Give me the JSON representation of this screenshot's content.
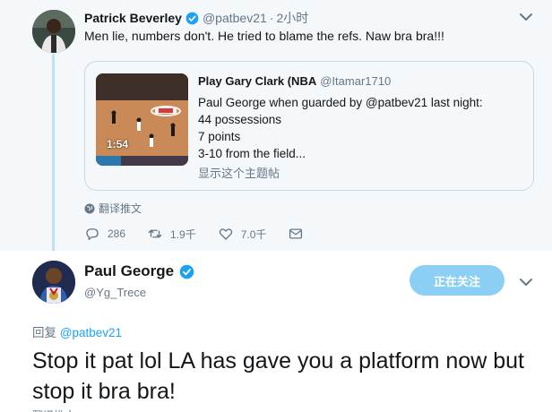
{
  "parent_tweet": {
    "author_name": "Patrick Beverley",
    "author_handle": "@patbev21",
    "separator": "·",
    "time": "2小时",
    "text": "Men lie, numbers don't. He tried to blame the refs. Naw bra bra!!!",
    "quote": {
      "author_name": "Play Gary Clark (NBA",
      "author_handle": "@Itamar1710",
      "lines": [
        "Paul George when guarded by @patbev21 last night:",
        "44 possessions",
        "7 points",
        "3-10 from the field..."
      ],
      "show_thread": "显示这个主题帖",
      "video_duration": "1:54"
    },
    "translate_label": "翻译推文",
    "actions": {
      "reply_count": "286",
      "retweet_count": "1.9千",
      "like_count": "7.0千"
    }
  },
  "reply_tweet": {
    "author_name": "Paul George",
    "author_handle": "@Yg_Trece",
    "follow_label": "正在关注",
    "reply_to_prefix": "回复",
    "reply_to_mention": "@patbev21",
    "text": "Stop it pat lol LA has gave you a platform now but stop it bra bra!"
  },
  "colors": {
    "accent": "#1da1f2",
    "follow_button": "#8ccff4",
    "thread_line": "#b9e3f7",
    "muted_text": "#657786",
    "parent_bg": "#f5f8fa"
  },
  "icons": {
    "verified": "verified-badge-icon",
    "chevron": "chevron-down-icon",
    "reply": "reply-icon",
    "retweet": "retweet-icon",
    "like": "heart-icon",
    "dm": "envelope-icon",
    "globe": "globe-icon"
  }
}
